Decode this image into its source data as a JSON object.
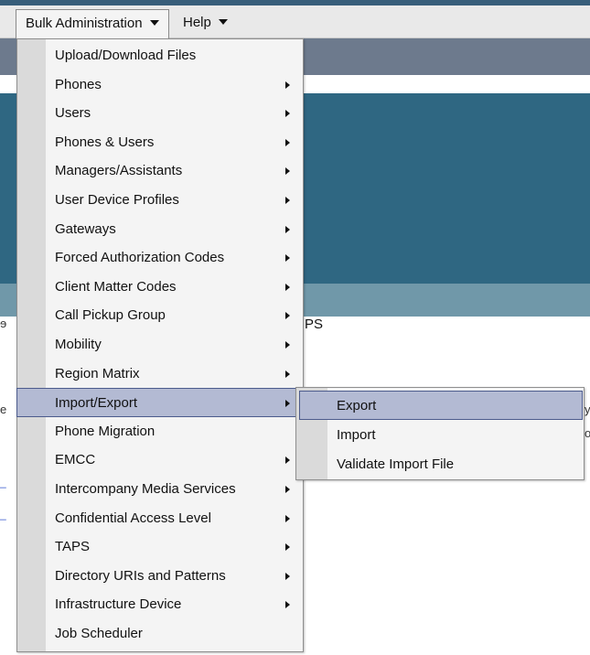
{
  "menubar": {
    "bulk_admin_label": "Bulk Administration",
    "help_label": "Help"
  },
  "background": {
    "fragment_ps": "PS",
    "fragment_left1": "ɘ",
    "fragment_left2": "e",
    "fragment_right1": "y",
    "fragment_right2": "o"
  },
  "dropdown": {
    "items": [
      {
        "label": "Upload/Download Files",
        "has_submenu": false
      },
      {
        "label": "Phones",
        "has_submenu": true
      },
      {
        "label": "Users",
        "has_submenu": true
      },
      {
        "label": "Phones & Users",
        "has_submenu": true
      },
      {
        "label": "Managers/Assistants",
        "has_submenu": true
      },
      {
        "label": "User Device Profiles",
        "has_submenu": true
      },
      {
        "label": "Gateways",
        "has_submenu": true
      },
      {
        "label": "Forced Authorization Codes",
        "has_submenu": true
      },
      {
        "label": "Client Matter Codes",
        "has_submenu": true
      },
      {
        "label": "Call Pickup Group",
        "has_submenu": true
      },
      {
        "label": "Mobility",
        "has_submenu": true
      },
      {
        "label": "Region Matrix",
        "has_submenu": true
      },
      {
        "label": "Import/Export",
        "has_submenu": true,
        "highlighted": true
      },
      {
        "label": "Phone Migration",
        "has_submenu": false
      },
      {
        "label": "EMCC",
        "has_submenu": true
      },
      {
        "label": "Intercompany Media Services",
        "has_submenu": true
      },
      {
        "label": "Confidential Access Level",
        "has_submenu": true
      },
      {
        "label": "TAPS",
        "has_submenu": true
      },
      {
        "label": "Directory URIs and Patterns",
        "has_submenu": true
      },
      {
        "label": "Infrastructure Device",
        "has_submenu": true
      },
      {
        "label": "Job Scheduler",
        "has_submenu": false
      }
    ]
  },
  "submenu": {
    "items": [
      {
        "label": "Export",
        "highlighted": true
      },
      {
        "label": "Import"
      },
      {
        "label": "Validate Import File"
      }
    ]
  },
  "colors": {
    "menu_highlight": "#b3bad3",
    "menu_highlight_border": "#4c5b8c",
    "header_teal": "#2f6782"
  }
}
